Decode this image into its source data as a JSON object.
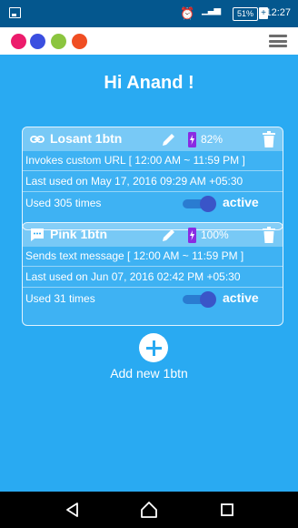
{
  "status_bar": {
    "battery_pct": "51%",
    "battery_plus": "+",
    "time": "12:27"
  },
  "app_bar": {
    "logo_dot_colors": [
      "#ec1c6c",
      "#3b4fe0",
      "#8bc53f",
      "#f04e23"
    ]
  },
  "greeting": "Hi Anand !",
  "cards": [
    {
      "icon": "link-icon",
      "title": "Losant 1btn",
      "battery": "82%",
      "action": "Invokes custom URL [ 12:00 AM ~ 11:59 PM ]",
      "last_used": "Last used on May 17, 2016 09:29 AM +05:30",
      "used": "Used 305 times",
      "active_label": "active",
      "active": true
    },
    {
      "icon": "message-icon",
      "title": "Pink 1btn",
      "battery": "100%",
      "action": "Sends text message [ 12:00 AM ~ 11:59 PM ]",
      "last_used": "Last used on Jun 07, 2016 02:42 PM +05:30",
      "used": "Used 31 times",
      "active_label": "active",
      "active": true
    }
  ],
  "add_new_label": "Add new 1btn",
  "colors": {
    "background": "#29aaf2",
    "status_bar": "#04578e",
    "toggle_knob": "#3a55c8",
    "battery_icon": "#8a2be2"
  }
}
